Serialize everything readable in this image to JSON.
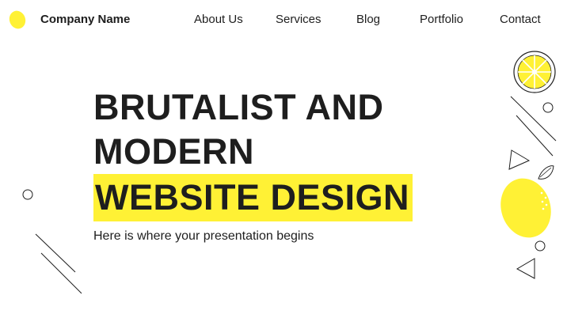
{
  "header": {
    "company_name": "Company Name",
    "logo_icon": "lemon-icon",
    "nav": [
      {
        "label": "About Us"
      },
      {
        "label": "Services"
      },
      {
        "label": "Blog"
      },
      {
        "label": "Portfolio"
      },
      {
        "label": "Contact"
      }
    ]
  },
  "hero": {
    "title_lines": [
      "BRUTALIST AND",
      "MODERN"
    ],
    "highlight": "WEBSITE DESIGN",
    "subtitle": "Here is where your presentation begins"
  },
  "colors": {
    "accent": "#fff135",
    "text": "#1e1e1e",
    "background": "#ffffff"
  },
  "decorations": {
    "icons": [
      "lemon-slice-icon",
      "lemon-icon",
      "leaf-icon",
      "triangle-icon",
      "circle-icon",
      "diagonal-line"
    ]
  }
}
